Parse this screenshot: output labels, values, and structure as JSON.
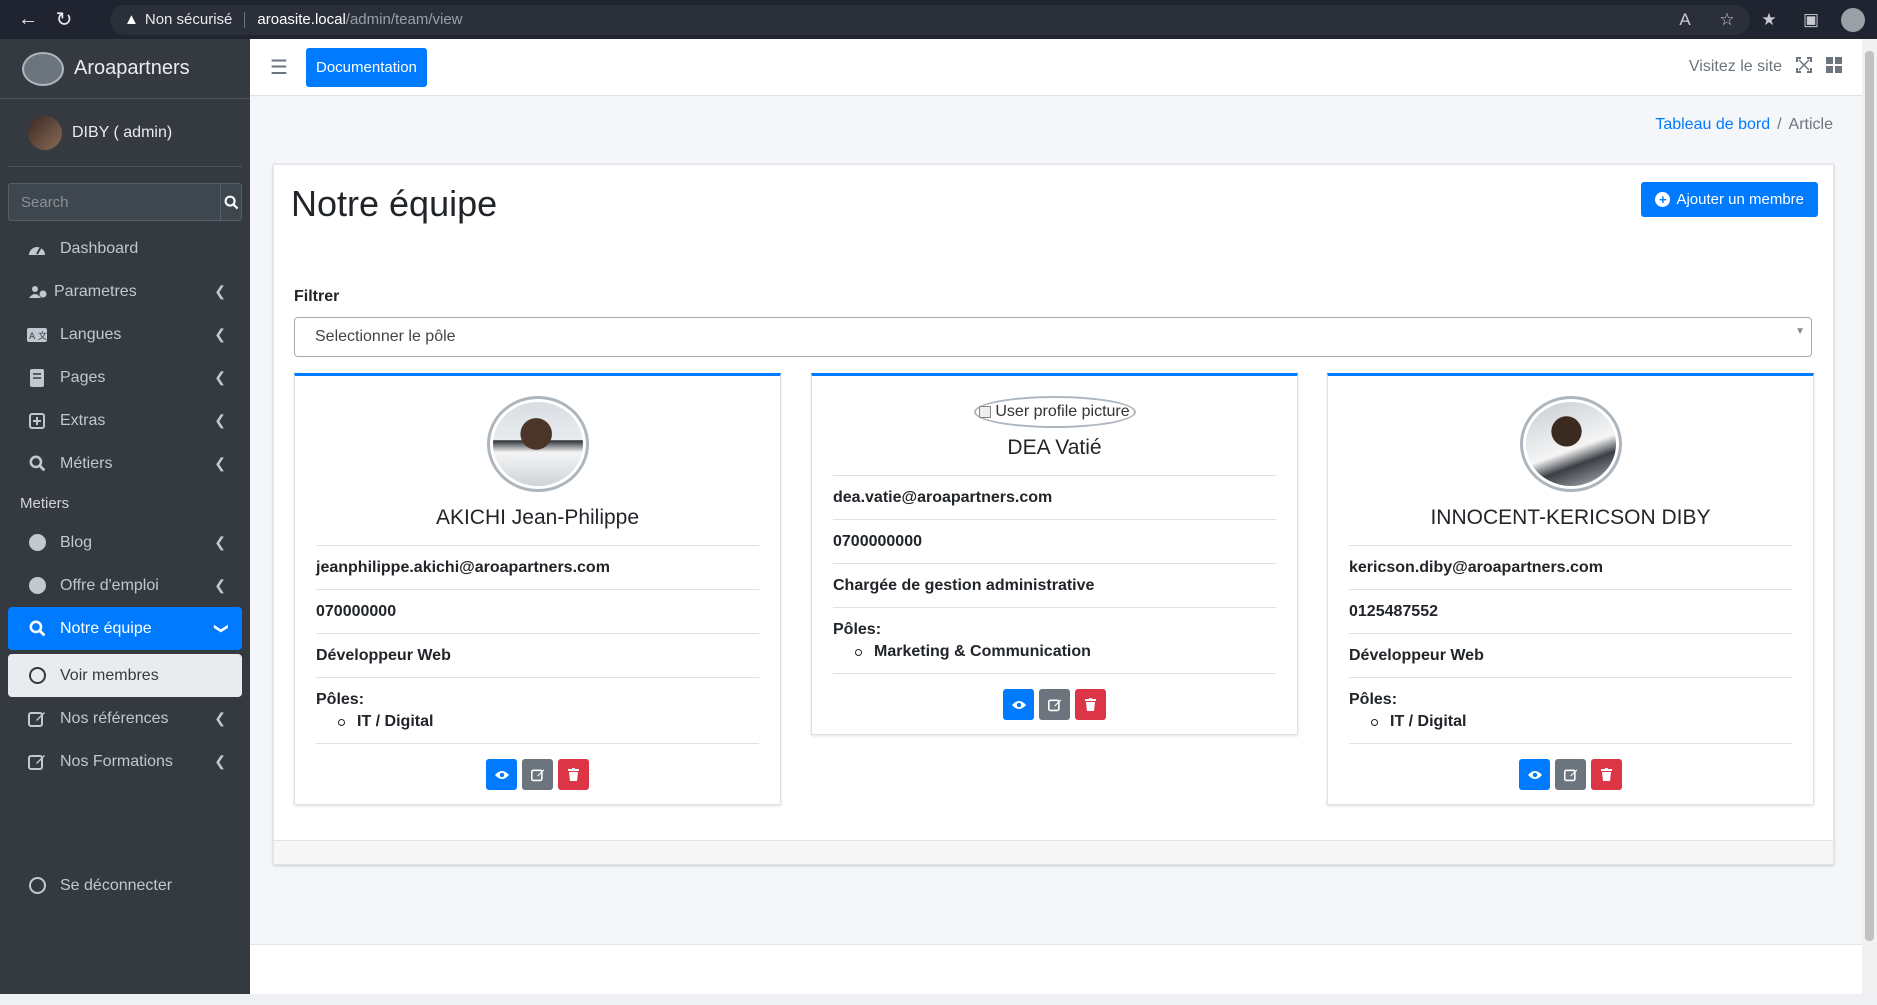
{
  "browser": {
    "security": "Non sécurisé",
    "url_host": "aroasite.local",
    "url_path": "/admin/team/view"
  },
  "sidebar": {
    "brand": "Aroapartners",
    "user": "DIBY ( admin)",
    "search_placeholder": "Search",
    "items": [
      {
        "label": "Dashboard"
      },
      {
        "label": "Parametres"
      },
      {
        "label": "Langues"
      },
      {
        "label": "Pages"
      },
      {
        "label": "Extras"
      },
      {
        "label": "Métiers"
      }
    ],
    "section_header": "Metiers",
    "items2": [
      {
        "label": "Blog"
      },
      {
        "label": "Offre d'emploi"
      },
      {
        "label": "Notre équipe"
      },
      {
        "label": "Voir membres"
      },
      {
        "label": "Nos références"
      },
      {
        "label": "Nos Formations"
      }
    ],
    "logout": "Se déconnecter"
  },
  "topbar": {
    "doc_button": "Documentation",
    "visit_site": "Visitez le site"
  },
  "breadcrumb": {
    "home": "Tableau de bord",
    "separator": "/",
    "current": "Article"
  },
  "main": {
    "title": "Notre équipe",
    "add_button": "Ajouter un membre",
    "filter_label": "Filtrer",
    "filter_placeholder": "Selectionner le pôle",
    "poles_label": "Pôles:",
    "broken_image_alt": "User profile picture",
    "members": [
      {
        "name": "AKICHI Jean-Philippe",
        "email": "jeanphilippe.akichi@aroapartners.com",
        "phone": "070000000",
        "role": "Développeur Web",
        "pole": "IT / Digital"
      },
      {
        "name": "DEA Vatié",
        "email": "dea.vatie@aroapartners.com",
        "phone": "0700000000",
        "role": "Chargée de gestion administrative",
        "pole": "Marketing & Communication"
      },
      {
        "name": "INNOCENT-KERICSON DIBY",
        "email": "kericson.diby@aroapartners.com",
        "phone": "0125487552",
        "role": "Développeur Web",
        "pole": "IT / Digital"
      }
    ]
  },
  "colors": {
    "primary": "#007bff",
    "sidebar_bg": "#343a40",
    "danger": "#dc3545",
    "secondary": "#6c757d"
  }
}
